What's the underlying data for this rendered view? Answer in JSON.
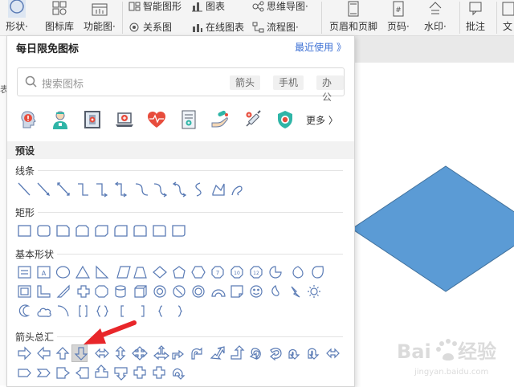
{
  "ribbon": {
    "shape_label": "形状·",
    "icon_lib_label": "图标库",
    "func_label": "功能图·",
    "smart_label": "智能图形",
    "chart_label": "图表",
    "mind_label": "思维导图·",
    "relation_label": "关系图",
    "online_chart_label": "在线图表",
    "flow_label": "流程图·",
    "header_footer_label": "页眉和页脚",
    "page_num_label": "页码·",
    "watermark_label": "水印·",
    "comment_label": "批注",
    "text_label": "文"
  },
  "left_strip_char": "表",
  "panel": {
    "title": "每日限免图标",
    "recent": "最近使用 》",
    "search_placeholder": "搜索图标",
    "tags": [
      "箭头",
      "手机",
      "办公"
    ],
    "more": "更多 〉",
    "preset_label": "预设",
    "sections": [
      "线条",
      "矩形",
      "基本形状",
      "箭头总汇"
    ]
  },
  "colors": {
    "diamond_fill": "#5b9bd5",
    "diamond_stroke": "#41719c",
    "shape_stroke": "#5a7bb5",
    "arrow_red": "#e8262a",
    "link": "#3b6fd4"
  }
}
